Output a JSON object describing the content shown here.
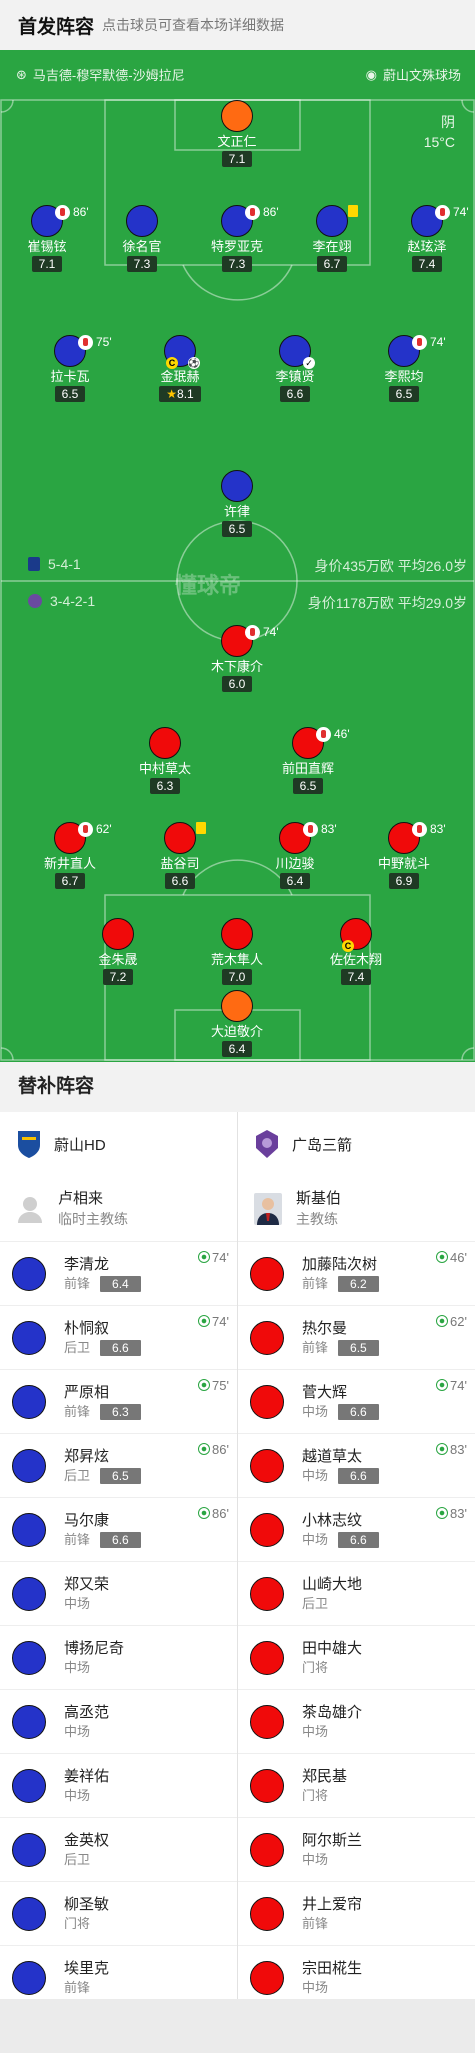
{
  "header": {
    "title": "首发阵容",
    "subtitle": "点击球员可查看本场详细数据"
  },
  "match": {
    "referee": "马吉德-穆罕默德-沙姆拉尼",
    "stadium": "蔚山文殊球场",
    "weather": "阴",
    "temperature": "15°C",
    "watermark": "懂球帝"
  },
  "home": {
    "formation": "5-4-1",
    "value": "身价435万欧",
    "age": "平均26.0岁",
    "color": "#2433c9"
  },
  "away": {
    "formation": "3-4-2-1",
    "value": "身价1178万欧",
    "age": "平均29.0岁",
    "color": "#f00a0a"
  },
  "home_players": [
    {
      "name": "文正仁",
      "rating": "7.1"
    },
    {
      "name": "崔锡铉",
      "rating": "7.1",
      "sub": "86'"
    },
    {
      "name": "徐名官",
      "rating": "7.3"
    },
    {
      "name": "特罗亚克",
      "rating": "7.3",
      "sub": "86'"
    },
    {
      "name": "李在翊",
      "rating": "6.7"
    },
    {
      "name": "赵玹泽",
      "rating": "7.4",
      "sub": "74'"
    },
    {
      "name": "拉卡瓦",
      "rating": "6.5",
      "sub": "75'"
    },
    {
      "name": "金珉赫",
      "rating": "8.1"
    },
    {
      "name": "李镇贤",
      "rating": "6.6"
    },
    {
      "name": "李熙均",
      "rating": "6.5",
      "sub": "74'"
    },
    {
      "name": "许律",
      "rating": "6.5"
    }
  ],
  "away_players": [
    {
      "name": "木下康介",
      "rating": "6.0",
      "sub": "74'"
    },
    {
      "name": "中村草太",
      "rating": "6.3"
    },
    {
      "name": "前田直辉",
      "rating": "6.5",
      "sub": "46'"
    },
    {
      "name": "新井直人",
      "rating": "6.7",
      "sub": "62'"
    },
    {
      "name": "盐谷司",
      "rating": "6.6"
    },
    {
      "name": "川边骏",
      "rating": "6.4",
      "sub": "83'"
    },
    {
      "name": "中野就斗",
      "rating": "6.9",
      "sub": "83'"
    },
    {
      "name": "金朱晟",
      "rating": "7.2"
    },
    {
      "name": "荒木隼人",
      "rating": "7.0"
    },
    {
      "name": "佐佐木翔",
      "rating": "7.4"
    },
    {
      "name": "大迫敬介",
      "rating": "6.4"
    }
  ],
  "subs": {
    "title": "替补阵容",
    "home": {
      "team": "蔚山HD",
      "coach": "卢相来",
      "coach_role": "临时主教练",
      "players": [
        {
          "name": "李清龙",
          "pos": "前锋",
          "rating": "6.4",
          "in": "74'"
        },
        {
          "name": "朴恫叙",
          "pos": "后卫",
          "rating": "6.6",
          "in": "74'"
        },
        {
          "name": "严原相",
          "pos": "前锋",
          "rating": "6.3",
          "in": "75'"
        },
        {
          "name": "郑昇炫",
          "pos": "后卫",
          "rating": "6.5",
          "in": "86'"
        },
        {
          "name": "马尔康",
          "pos": "前锋",
          "rating": "6.6",
          "in": "86'"
        },
        {
          "name": "郑又荣",
          "pos": "中场"
        },
        {
          "name": "博扬尼奇",
          "pos": "中场"
        },
        {
          "name": "高丞范",
          "pos": "中场"
        },
        {
          "name": "姜祥佑",
          "pos": "中场"
        },
        {
          "name": "金英权",
          "pos": "后卫"
        },
        {
          "name": "柳圣敏",
          "pos": "门将"
        },
        {
          "name": "埃里克",
          "pos": "前锋"
        }
      ]
    },
    "away": {
      "team": "广岛三箭",
      "coach": "斯基伯",
      "coach_role": "主教练",
      "players": [
        {
          "name": "加藤陆次树",
          "pos": "前锋",
          "rating": "6.2",
          "in": "46'"
        },
        {
          "name": "热尔曼",
          "pos": "前锋",
          "rating": "6.5",
          "in": "62'"
        },
        {
          "name": "菅大辉",
          "pos": "中场",
          "rating": "6.6",
          "in": "74'"
        },
        {
          "name": "越道草太",
          "pos": "中场",
          "rating": "6.6",
          "in": "83'"
        },
        {
          "name": "小林志纹",
          "pos": "中场",
          "rating": "6.6",
          "in": "83'"
        },
        {
          "name": "山崎大地",
          "pos": "后卫"
        },
        {
          "name": "田中雄大",
          "pos": "门将"
        },
        {
          "name": "茶岛雄介",
          "pos": "中场"
        },
        {
          "name": "郑民基",
          "pos": "门将"
        },
        {
          "name": "阿尔斯兰",
          "pos": "中场"
        },
        {
          "name": "井上爱帘",
          "pos": "前锋"
        },
        {
          "name": "宗田椛生",
          "pos": "中场"
        }
      ]
    }
  }
}
